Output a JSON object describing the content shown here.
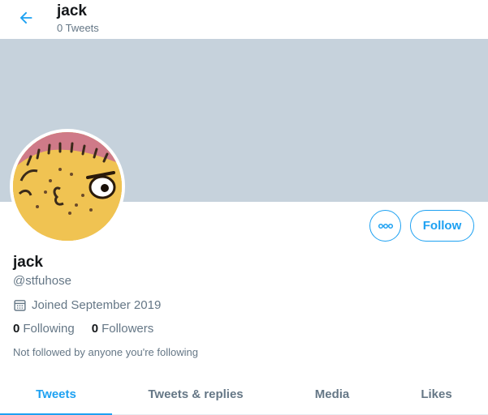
{
  "header": {
    "title": "jack",
    "subtitle": "0 Tweets",
    "back_icon": "arrow-left-icon"
  },
  "banner": {
    "color": "#c6d2dc"
  },
  "profile": {
    "name": "jack",
    "handle": "@stfuhose",
    "joined": "Joined September 2019",
    "joined_icon": "calendar-icon",
    "following_count": "0",
    "following_label": "Following",
    "followers_count": "0",
    "followers_label": "Followers",
    "mutual_note": "Not followed by anyone you're following"
  },
  "actions": {
    "more_icon": "more-dots-icon",
    "follow_label": "Follow"
  },
  "tabs": [
    {
      "label": "Tweets",
      "active": true
    },
    {
      "label": "Tweets & replies",
      "active": false
    },
    {
      "label": "Media",
      "active": false
    },
    {
      "label": "Likes",
      "active": false
    }
  ],
  "colors": {
    "accent": "#1da1f2",
    "text": "#14171a",
    "secondary": "#657786"
  }
}
